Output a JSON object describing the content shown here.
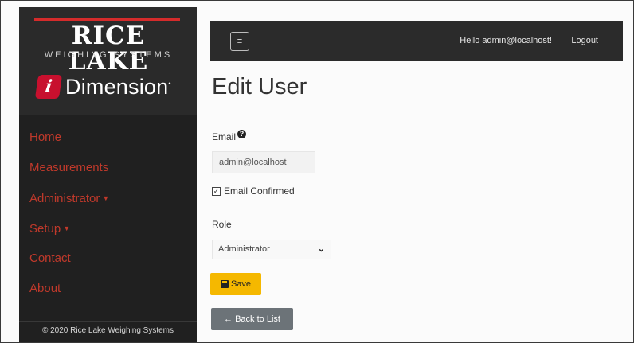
{
  "brand": {
    "name": "RICE LAKE",
    "subtitle": "WEIGHING SYSTEMS",
    "product_badge": "i",
    "product_name": "Dimension",
    "accent": "#c8102e"
  },
  "nav": {
    "items": [
      {
        "label": "Home",
        "has_caret": false
      },
      {
        "label": "Measurements",
        "has_caret": false
      },
      {
        "label": "Administrator",
        "has_caret": true
      },
      {
        "label": "Setup",
        "has_caret": true
      },
      {
        "label": "Contact",
        "has_caret": false
      },
      {
        "label": "About",
        "has_caret": false
      }
    ],
    "caret_glyph": "▼"
  },
  "footer": {
    "text": "© 2020 Rice Lake Weighing Systems"
  },
  "topbar": {
    "toggler_icon": "≡",
    "greeting": "Hello admin@localhost!",
    "logout": "Logout"
  },
  "form": {
    "title": "Edit User",
    "email_label": "Email",
    "help_icon": "?",
    "email_value": "admin@localhost",
    "email_confirmed_label": "Email Confirmed",
    "email_confirmed": true,
    "checkmark": "✓",
    "role_label": "Role",
    "role_value": "Administrator",
    "role_chevron": "⌄",
    "save_label": "Save",
    "back_label": "← Back to List"
  },
  "colors": {
    "sidebar": "#202020",
    "nav_text": "#c0392b",
    "topbar": "#2b2b2b",
    "save": "#f5b800",
    "back": "#6c7378"
  }
}
